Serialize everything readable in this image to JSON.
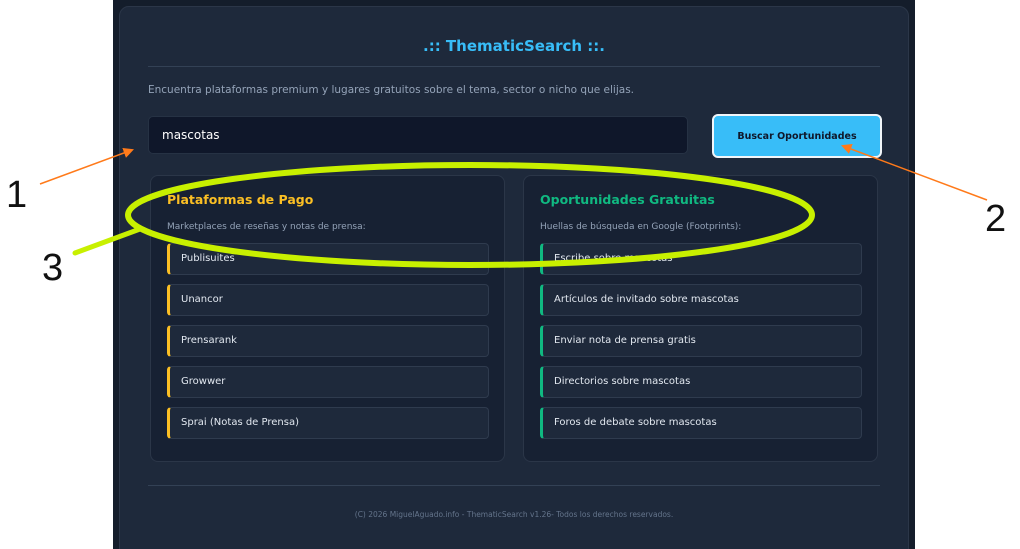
{
  "app": {
    "title": ".:: ThematicSearch ::.",
    "subtitle": "Encuentra plataformas premium y lugares gratuitos sobre el tema, sector o nicho que elijas."
  },
  "search": {
    "value": "mascotas",
    "button_label": "Buscar Oportunidades"
  },
  "paid": {
    "title": "Plataformas de Pago",
    "description": "Marketplaces de reseñas y notas de prensa:",
    "items": [
      "Publisuites",
      "Unancor",
      "Prensarank",
      "Growwer",
      "Sprai (Notas de Prensa)"
    ]
  },
  "free": {
    "title": "Oportunidades Gratuitas",
    "description": "Huellas de búsqueda en Google (Footprints):",
    "items": [
      "Escribe sobre mascotas",
      "Artículos de invitado sobre mascotas",
      "Enviar nota de prensa gratis",
      "Directorios sobre mascotas",
      "Foros de debate sobre mascotas"
    ]
  },
  "footer": {
    "text": "(C) 2026 MiguelAguado.info - ThematicSearch v1.26- Todos los derechos reservados."
  },
  "annotations": {
    "labels": [
      "1",
      "2",
      "3"
    ],
    "arrow_color": "#ff7a1a",
    "highlight_color": "#c8f000"
  },
  "colors": {
    "accent": "#38bdf8",
    "paid": "#fbbf24",
    "free": "#10b981",
    "panel": "#1e293b"
  }
}
